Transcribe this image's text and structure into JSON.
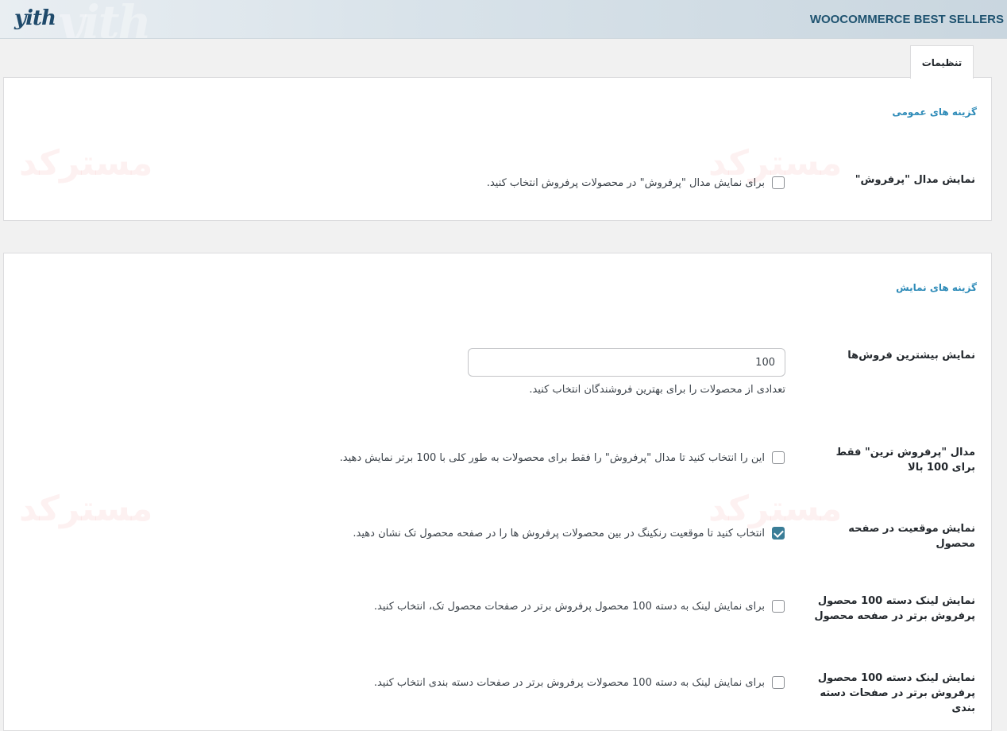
{
  "header": {
    "logo": "yith",
    "plugin_title": "WOOCOMMERCE BEST SELLERS"
  },
  "tabs": [
    {
      "label": "تنظیمات"
    }
  ],
  "general": {
    "section_title": "گزینه های عمومی",
    "badge": {
      "label": "نمایش مدال \"پرفروش\"",
      "description": "برای نمایش مدال \"پرفروش\" در محصولات پرفروش انتخاب کنید.",
      "checked": false
    }
  },
  "display": {
    "section_title": "گزینه های نمایش",
    "bestsellers_count": {
      "label": "نمایش بیشترین فروش‌ها",
      "value": "100",
      "description": "تعدادی از محصولات را برای بهترین فروشندگان انتخاب کنید."
    },
    "top100_badge": {
      "label": "مدال \"پرفروش ترین\" فقط برای 100 بالا",
      "description": "این را انتخاب کنید تا مدال \"پرفروش\" را فقط برای محصولات به طور کلی با 100 برتر نمایش دهید.",
      "checked": false
    },
    "position_on_product": {
      "label": "نمایش موقعیت در صفحه محصول",
      "description": "انتخاب کنید تا موقعیت رنکینگ در بین محصولات پرفروش ها را در صفحه محصول تک نشان دهید.",
      "checked": true
    },
    "link_on_product": {
      "label": "نمایش لینک دسته 100 محصول پرفروش برتر در صفحه محصول",
      "description": "برای نمایش لینک به دسته 100 محصول پرفروش برتر در صفحات محصول تک، انتخاب کنید.",
      "checked": false
    },
    "link_on_category": {
      "label": "نمایش لینک دسته 100 محصول پرفروش برتر در صفحات دسته بندی",
      "description": "برای نمایش لینک به دسته 100 محصولات پرفروش برتر در صفحات دسته بندی انتخاب کنید.",
      "checked": false
    }
  },
  "watermark": "مسترکد",
  "colors": {
    "accent": "#2e8bb8",
    "checkbox_checked": "#3a7d97",
    "title": "#1f5370"
  }
}
